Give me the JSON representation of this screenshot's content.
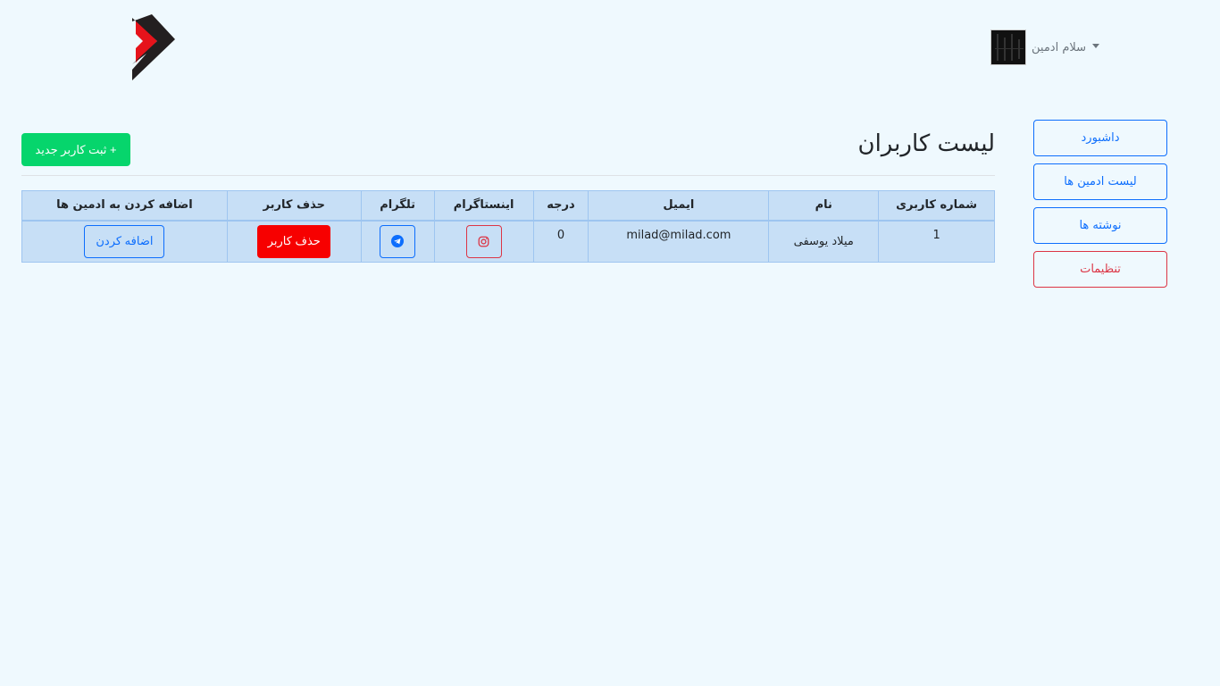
{
  "header": {
    "user_greeting": "سلام ادمین"
  },
  "sidebar": {
    "items": [
      {
        "label": "داشبورد",
        "variant": "primary"
      },
      {
        "label": "لیست ادمین ها",
        "variant": "primary"
      },
      {
        "label": "نوشته ها",
        "variant": "primary"
      },
      {
        "label": "تنظیمات",
        "variant": "danger"
      }
    ]
  },
  "main": {
    "title": "لیست کاربران",
    "add_user_label": "+ ثبت کاربر جدید",
    "table": {
      "headers": [
        "شماره کاربری",
        "نام",
        "ایمیل",
        "درجه",
        "اینستاگرام",
        "تلگرام",
        "حذف کاربر",
        "اضافه کردن به ادمین ها"
      ],
      "rows": [
        {
          "id": "1",
          "name": "میلاد یوسفی",
          "email": "milad@milad.com",
          "rank": "0",
          "instagram_icon": "instagram-icon",
          "telegram_icon": "telegram-icon",
          "delete_label": "حذف کاربر",
          "add_admin_label": "اضافه کردن"
        }
      ]
    }
  },
  "colors": {
    "background": "#eff9fe",
    "primary": "#0d6efd",
    "danger": "#dc3545",
    "success": "#06d56c",
    "delete": "#f70000",
    "table_bg": "#c7dff6",
    "logo_red": "#e6131b",
    "logo_dark": "#231f20"
  }
}
